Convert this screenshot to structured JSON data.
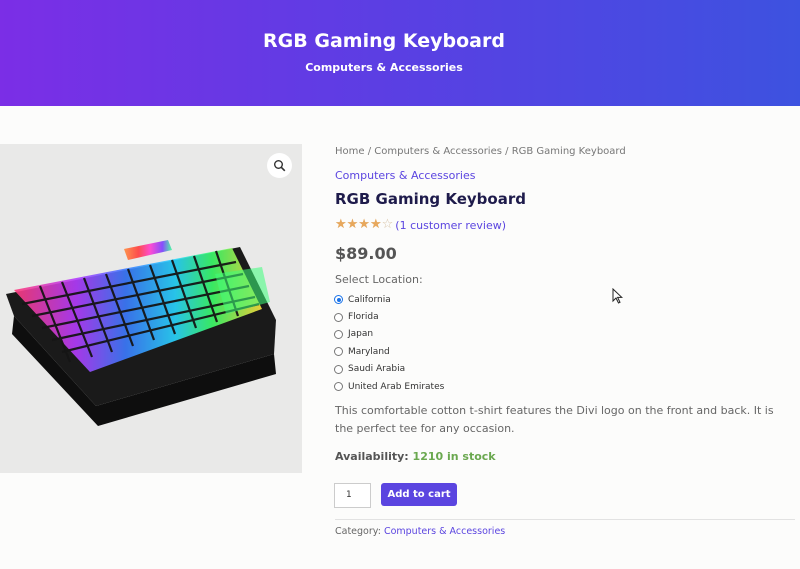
{
  "hero": {
    "title": "RGB Gaming Keyboard",
    "subtitle": "Computers & Accessories"
  },
  "breadcrumb": {
    "home": "Home",
    "sep1": " / ",
    "category": "Computers & Accessories",
    "sep2": " / ",
    "current": "RGB Gaming Keyboard"
  },
  "product": {
    "category_link": "Computers & Accessories",
    "title": "RGB Gaming Keyboard",
    "rating_value": 4,
    "rating_max": 5,
    "review_link": "(1 customer review)",
    "price": "$89.00",
    "location_label": "Select Location:",
    "locations": [
      "California",
      "Florida",
      "Japan",
      "Maryland",
      "Saudi Arabia",
      "United Arab Emirates"
    ],
    "selected_location": "California",
    "description": "This comfortable cotton t-shirt features the Divi logo on the front and back. It is the perfect tee for any occasion.",
    "availability_label": "Availability:",
    "availability_value": "1210 in stock",
    "quantity": "1",
    "add_to_cart": "Add to cart",
    "category_label": "Category:",
    "category_value": "Computers & Accessories"
  },
  "icons": {
    "zoom": "magnifier-icon",
    "star": "star-icon",
    "cursor": "mouse-pointer-icon"
  },
  "colors": {
    "accent": "#5b45e0",
    "hero_start": "#7b2ee6",
    "hero_end": "#3d52e0",
    "in_stock": "#6aa84f",
    "star": "#e8a85c"
  }
}
